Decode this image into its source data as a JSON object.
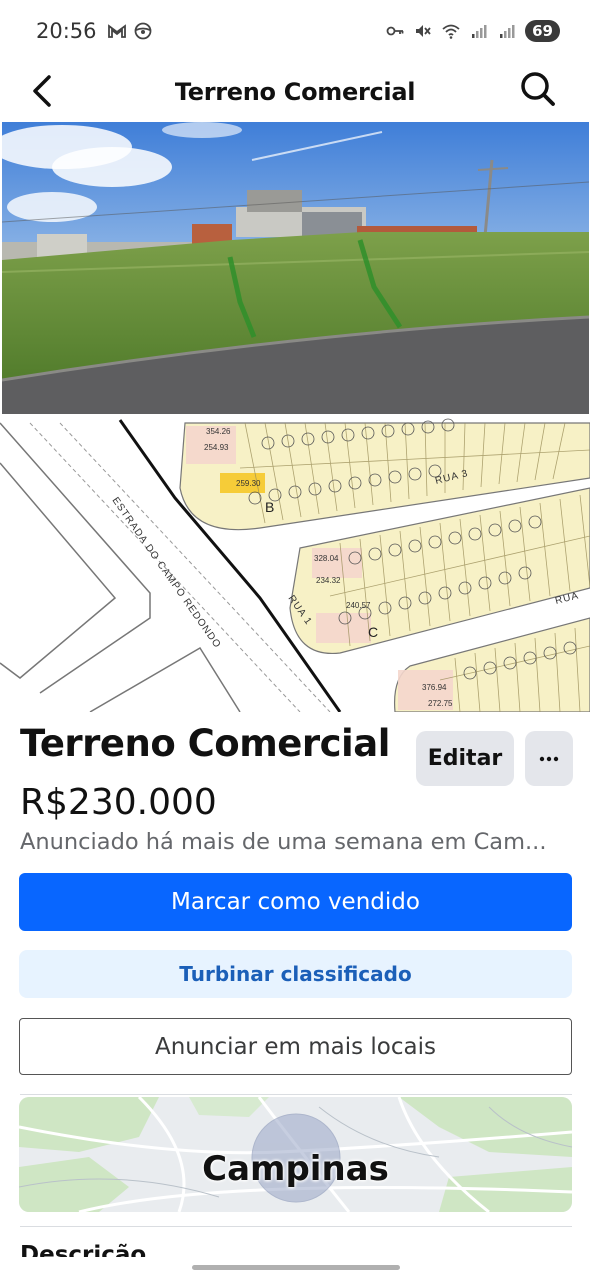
{
  "status_bar": {
    "time": "20:56",
    "battery": "69",
    "left_icons": [
      "gmail-icon",
      "steering-wheel-icon"
    ],
    "right_icons": [
      "key-icon",
      "mute-icon",
      "wifi-icon",
      "signal-icon",
      "signal-icon"
    ]
  },
  "nav": {
    "title": "Terreno Comercial",
    "back_icon": "back-arrow-icon",
    "search_icon": "search-icon"
  },
  "photos": {
    "street_photo": "street-view-photo",
    "lot_map": {
      "street_1": "ESTRADA DO CAMPO REDONDO",
      "street_2": "RUA 1",
      "street_3": "RUA 3",
      "street_4": "RUA",
      "block_b": "B",
      "block_c": "C",
      "area_1": "354.26",
      "area_2": "254.93",
      "area_3": "259.30",
      "area_4": "328.04",
      "area_5": "234.32",
      "area_6": "240.57",
      "area_7": "376.94",
      "area_8": "272.75"
    }
  },
  "listing": {
    "title": "Terreno Comercial",
    "price": "R$230.000",
    "posted": "Anunciado há mais de uma semana em Cam...",
    "edit_label": "Editar",
    "more_label": "···"
  },
  "actions": {
    "mark_sold": "Marcar como vendido",
    "boost": "Turbinar classificado",
    "more_places": "Anunciar em mais locais"
  },
  "location": {
    "city": "Campinas"
  },
  "description": {
    "heading": "Descrição"
  },
  "colors": {
    "primary": "#0866ff",
    "boost_bg": "#e7f3ff",
    "boost_text": "#1b5fb8",
    "secondary_bg": "#e4e6eb"
  }
}
